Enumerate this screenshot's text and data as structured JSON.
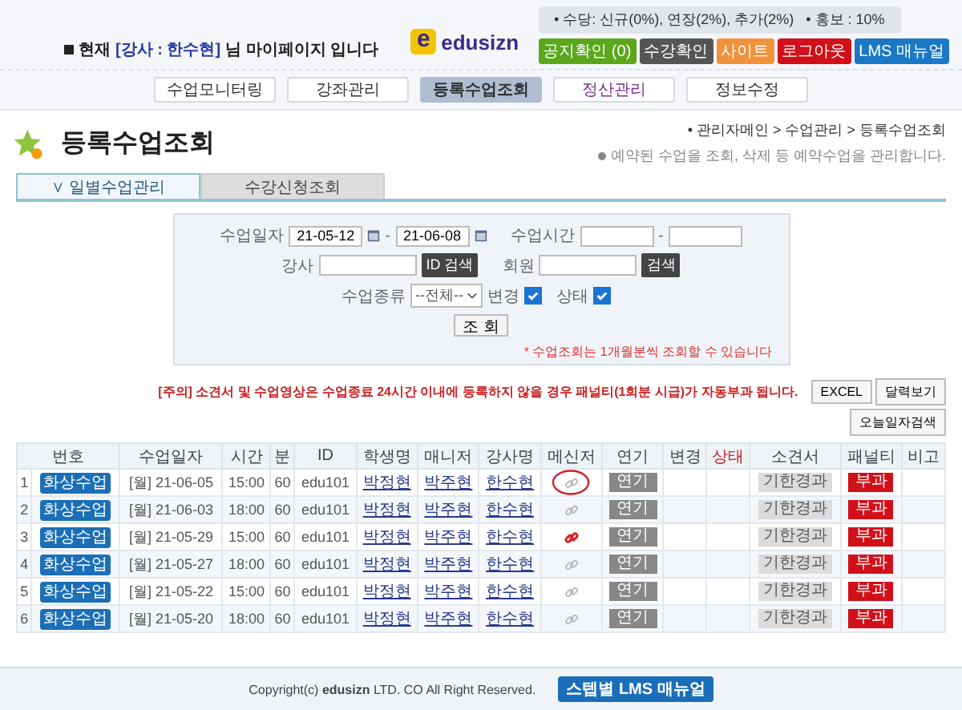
{
  "header": {
    "greeting": {
      "prefix": "현재",
      "highlight": "[강사 : 한수현]",
      "suffix": "님 마이페이지 입니다"
    },
    "logo": {
      "mark": "e",
      "name": "edusizn"
    },
    "info": "• 수당: 신규(0%), 연장(2%), 추가(2%)   • 홍보 : 10%",
    "buttons": [
      {
        "label": "공지확인 (0)",
        "kind": "green"
      },
      {
        "label": "수강확인",
        "kind": "dark"
      },
      {
        "label": "사이트",
        "kind": "orange"
      },
      {
        "label": "로그아웃",
        "kind": "red"
      },
      {
        "label": "LMS 매뉴얼",
        "kind": "blue"
      }
    ]
  },
  "nav": [
    {
      "label": "수업모니터링",
      "selected": false,
      "visited": false
    },
    {
      "label": "강좌관리",
      "selected": false,
      "visited": false
    },
    {
      "label": "등록수업조회",
      "selected": true,
      "visited": false
    },
    {
      "label": "정산관리",
      "selected": false,
      "visited": true
    },
    {
      "label": "정보수정",
      "selected": false,
      "visited": false
    }
  ],
  "page": {
    "title": "등록수업조회",
    "breadcrumb": "• 관리자메인 > 수업관리 > 등록수업조회",
    "description": "예약된 수업을 조회, 삭제 등 예약수업을 관리합니다."
  },
  "tabs": [
    {
      "label": "∨ 일별수업관리",
      "selected": true
    },
    {
      "label": "수강신청조회",
      "selected": false
    }
  ],
  "search": {
    "date_label": "수업일자",
    "date_from": "21-05-12",
    "date_to": "21-06-08",
    "dash": "-",
    "time_label": "수업시간",
    "teacher_label": "강사",
    "id_search": "ID 검색",
    "member_label": "회원",
    "member_search": "검색",
    "type_label": "수업종류",
    "type_value": "--전체--",
    "change_label": "변경",
    "change_checked": true,
    "status_label": "상태",
    "status_checked": true,
    "submit": "조 회",
    "hint": "* 수업조회는 1개월분씩 조회할 수 있습니다"
  },
  "notice": "[주의] 소견서 및 수업영상은 수업종료 24시간 이내에 등록하지 않을 경우 패널티(1회분 시급)가 자동부과 됩니다.",
  "actions": [
    "EXCEL",
    "달력보기",
    "오늘일자검색"
  ],
  "table": {
    "columns": [
      "번호",
      "수업일자",
      "시간",
      "분",
      "ID",
      "학생명",
      "매니저",
      "강사명",
      "메신저",
      "연기",
      "변경",
      "상태",
      "소견서",
      "패널티",
      "비고"
    ],
    "rows": [
      {
        "no": "1",
        "class_button": "화상수업",
        "date": "[월] 21-06-05",
        "time": "15:00",
        "minutes": "60",
        "id": "edu101",
        "student": "박정현",
        "manager": "박주현",
        "teacher": "한수현",
        "link_active": false,
        "circled": true,
        "postpone": "연기",
        "report": "기한경과",
        "penalty": "부과"
      },
      {
        "no": "2",
        "class_button": "화상수업",
        "date": "[월] 21-06-03",
        "time": "18:00",
        "minutes": "60",
        "id": "edu101",
        "student": "박정현",
        "manager": "박주현",
        "teacher": "한수현",
        "link_active": false,
        "circled": false,
        "postpone": "연기",
        "report": "기한경과",
        "penalty": "부과"
      },
      {
        "no": "3",
        "class_button": "화상수업",
        "date": "[월] 21-05-29",
        "time": "15:00",
        "minutes": "60",
        "id": "edu101",
        "student": "박정현",
        "manager": "박주현",
        "teacher": "한수현",
        "link_active": true,
        "circled": false,
        "postpone": "연기",
        "report": "기한경과",
        "penalty": "부과"
      },
      {
        "no": "4",
        "class_button": "화상수업",
        "date": "[월] 21-05-27",
        "time": "18:00",
        "minutes": "60",
        "id": "edu101",
        "student": "박정현",
        "manager": "박주현",
        "teacher": "한수현",
        "link_active": false,
        "circled": false,
        "postpone": "연기",
        "report": "기한경과",
        "penalty": "부과"
      },
      {
        "no": "5",
        "class_button": "화상수업",
        "date": "[월] 21-05-22",
        "time": "15:00",
        "minutes": "60",
        "id": "edu101",
        "student": "박정현",
        "manager": "박주현",
        "teacher": "한수현",
        "link_active": false,
        "circled": false,
        "postpone": "연기",
        "report": "기한경과",
        "penalty": "부과"
      },
      {
        "no": "6",
        "class_button": "화상수업",
        "date": "[월] 21-05-20",
        "time": "18:00",
        "minutes": "60",
        "id": "edu101",
        "student": "박정현",
        "manager": "박주현",
        "teacher": "한수현",
        "link_active": false,
        "circled": false,
        "postpone": "연기",
        "report": "기한경과",
        "penalty": "부과"
      }
    ]
  },
  "footer": {
    "copyright": "Copyright(c) **edusizn** LTD. CO All Right Reserved.",
    "manual_button": "스텝별 LMS 매뉴얼"
  }
}
